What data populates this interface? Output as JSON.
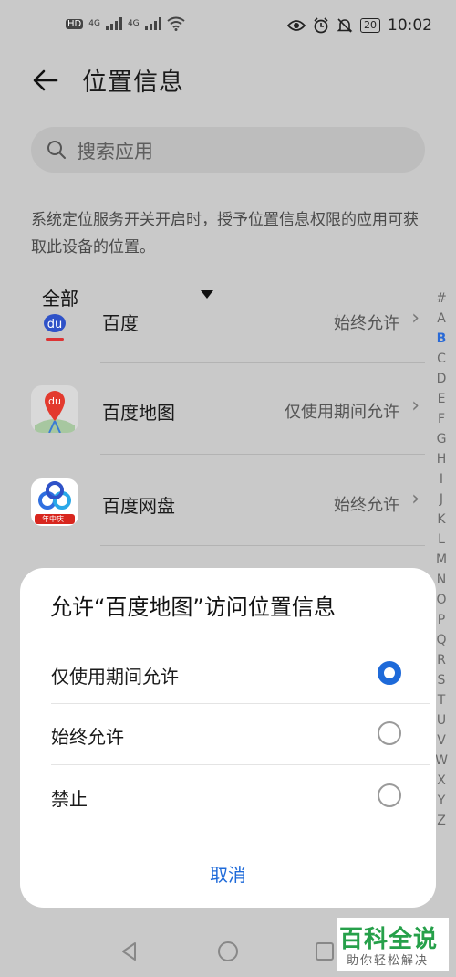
{
  "status_bar": {
    "network_labels": [
      "HD",
      "4G",
      "4G"
    ],
    "battery": "20",
    "time": "10:02"
  },
  "header": {
    "title": "位置信息"
  },
  "search": {
    "placeholder": "搜索应用"
  },
  "description": "系统定位服务开关开启时，授予位置信息权限的应用可获取此设备的位置。",
  "filter": {
    "label": "全部"
  },
  "apps": [
    {
      "name": "百度",
      "permission": "始终允许",
      "icon": "baidu-icon"
    },
    {
      "name": "百度地图",
      "permission": "仅使用期间允许",
      "icon": "baidu-map-icon"
    },
    {
      "name": "百度网盘",
      "permission": "始终允许",
      "icon": "baidu-netdisk-icon",
      "badge": "年中庆"
    }
  ],
  "index_letters": [
    "#",
    "A",
    "B",
    "C",
    "D",
    "E",
    "F",
    "G",
    "H",
    "I",
    "J",
    "K",
    "L",
    "M",
    "N",
    "O",
    "P",
    "Q",
    "R",
    "S",
    "T",
    "U",
    "V",
    "W",
    "X",
    "Y",
    "Z"
  ],
  "index_active": "B",
  "dialog": {
    "title": "允许“百度地图”访问位置信息",
    "options": [
      {
        "label": "仅使用期间允许",
        "selected": true
      },
      {
        "label": "始终允许",
        "selected": false
      },
      {
        "label": "禁止",
        "selected": false
      }
    ],
    "cancel": "取消"
  },
  "watermark": {
    "title": "百科全说",
    "subtitle": "助你轻松解决"
  },
  "colors": {
    "accent": "#1e6ad9",
    "watermark_green": "#26a04a",
    "dim_background": "#c9c9c9"
  }
}
